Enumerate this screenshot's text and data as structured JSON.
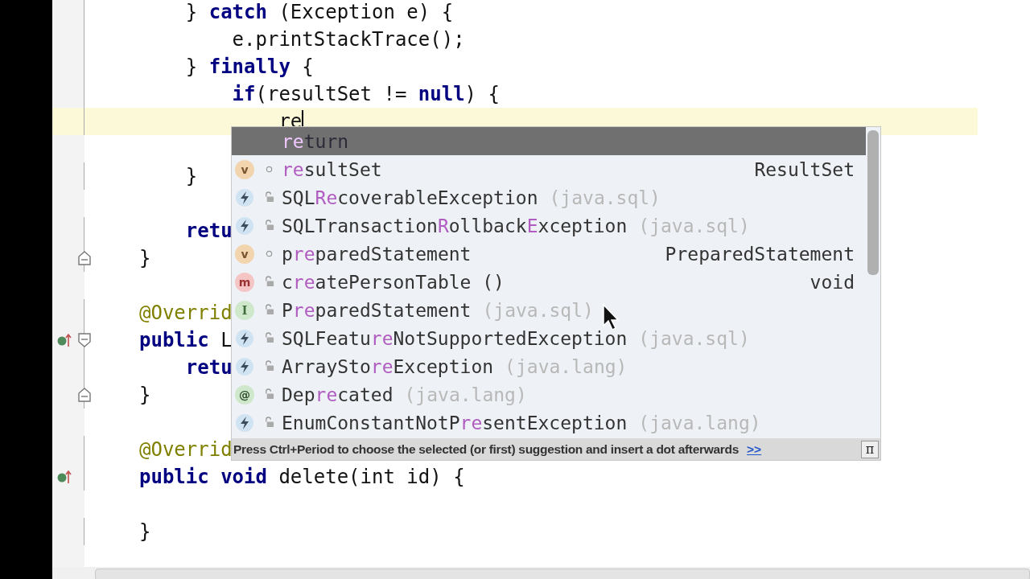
{
  "editor": {
    "lines": [
      {
        "text": "    } **catch** (Exception e) {"
      },
      {
        "text": "        e.printStackTrace();"
      },
      {
        "text": "    } **finally** {"
      },
      {
        "text": "        **if**(resultSet != **null**) {"
      },
      {
        "text": "            re",
        "current": true
      },
      {
        "text": "    }",
        "gap_before": true
      },
      {
        "text": "    **retu**",
        "gap_before": true
      },
      {
        "text": "}",
        "fold_end": true
      },
      {
        "text": "@Overrid",
        "kind": "annotation",
        "gap_before": true
      },
      {
        "text": "**public** L",
        "fold_start": true,
        "override": true
      },
      {
        "text": "    **retu**"
      },
      {
        "text": "}",
        "fold_end": true
      },
      {
        "text": "@Overrid",
        "kind": "annotation",
        "gap_before": true
      },
      {
        "text": "**public** **void** delete(int id) {",
        "override": true
      },
      {
        "text": "}",
        "gap_before": true
      }
    ]
  },
  "completion": {
    "items": [
      {
        "kind": "keyword",
        "selected": true,
        "parts": [
          {
            "text": "re",
            "match": true
          },
          {
            "text": "turn"
          }
        ]
      },
      {
        "kind": "variable",
        "badge": "v",
        "local": true,
        "selected": false,
        "parts": [
          {
            "text": "re",
            "match": true
          },
          {
            "text": "sultSet"
          }
        ],
        "type": "ResultSet"
      },
      {
        "kind": "exception",
        "local": false,
        "selected": false,
        "parts": [
          {
            "text": "SQL"
          },
          {
            "text": "Re",
            "match": true
          },
          {
            "text": "coverableException"
          }
        ],
        "package": "(java.sql)"
      },
      {
        "kind": "exception",
        "local": false,
        "selected": false,
        "parts": [
          {
            "text": "SQLTransaction"
          },
          {
            "text": "R",
            "match": true
          },
          {
            "text": "ollback"
          },
          {
            "text": "E",
            "match": true
          },
          {
            "text": "xception"
          }
        ],
        "package": "(java.sql)"
      },
      {
        "kind": "variable",
        "badge": "v",
        "local": true,
        "selected": false,
        "parts": [
          {
            "text": "p"
          },
          {
            "text": "re",
            "match": true
          },
          {
            "text": "paredStatement"
          }
        ],
        "type": "PreparedStatement"
      },
      {
        "kind": "method",
        "badge": "m",
        "local": false,
        "selected": false,
        "parts": [
          {
            "text": "c"
          },
          {
            "text": "re",
            "match": true
          },
          {
            "text": "atePersonTable ()"
          }
        ],
        "type": "void"
      },
      {
        "kind": "interface",
        "badge": "I",
        "local": false,
        "selected": false,
        "parts": [
          {
            "text": "P"
          },
          {
            "text": "re",
            "match": true
          },
          {
            "text": "paredStatement"
          }
        ],
        "package": "(java.sql)"
      },
      {
        "kind": "exception",
        "local": false,
        "selected": false,
        "parts": [
          {
            "text": "SQLFeatu"
          },
          {
            "text": "re",
            "match": true
          },
          {
            "text": "NotSupportedException"
          }
        ],
        "package": "(java.sql)"
      },
      {
        "kind": "exception",
        "local": false,
        "selected": false,
        "parts": [
          {
            "text": "ArraySto"
          },
          {
            "text": "re",
            "match": true
          },
          {
            "text": "Exception"
          }
        ],
        "package": "(java.lang)"
      },
      {
        "kind": "annotation",
        "badge": "@",
        "local": false,
        "selected": false,
        "parts": [
          {
            "text": "Dep"
          },
          {
            "text": "re",
            "match": true
          },
          {
            "text": "cated"
          }
        ],
        "package": "(java.lang)"
      },
      {
        "kind": "exception",
        "local": false,
        "selected": false,
        "parts": [
          {
            "text": "EnumConstantNotP"
          },
          {
            "text": "re",
            "match": true
          },
          {
            "text": "sentException"
          }
        ],
        "package": "(java.lang)"
      }
    ],
    "hint": "Press Ctrl+Period to choose the selected (or first) suggestion and insert a dot afterwards",
    "hint_link": ">>",
    "pi_button": "π"
  }
}
